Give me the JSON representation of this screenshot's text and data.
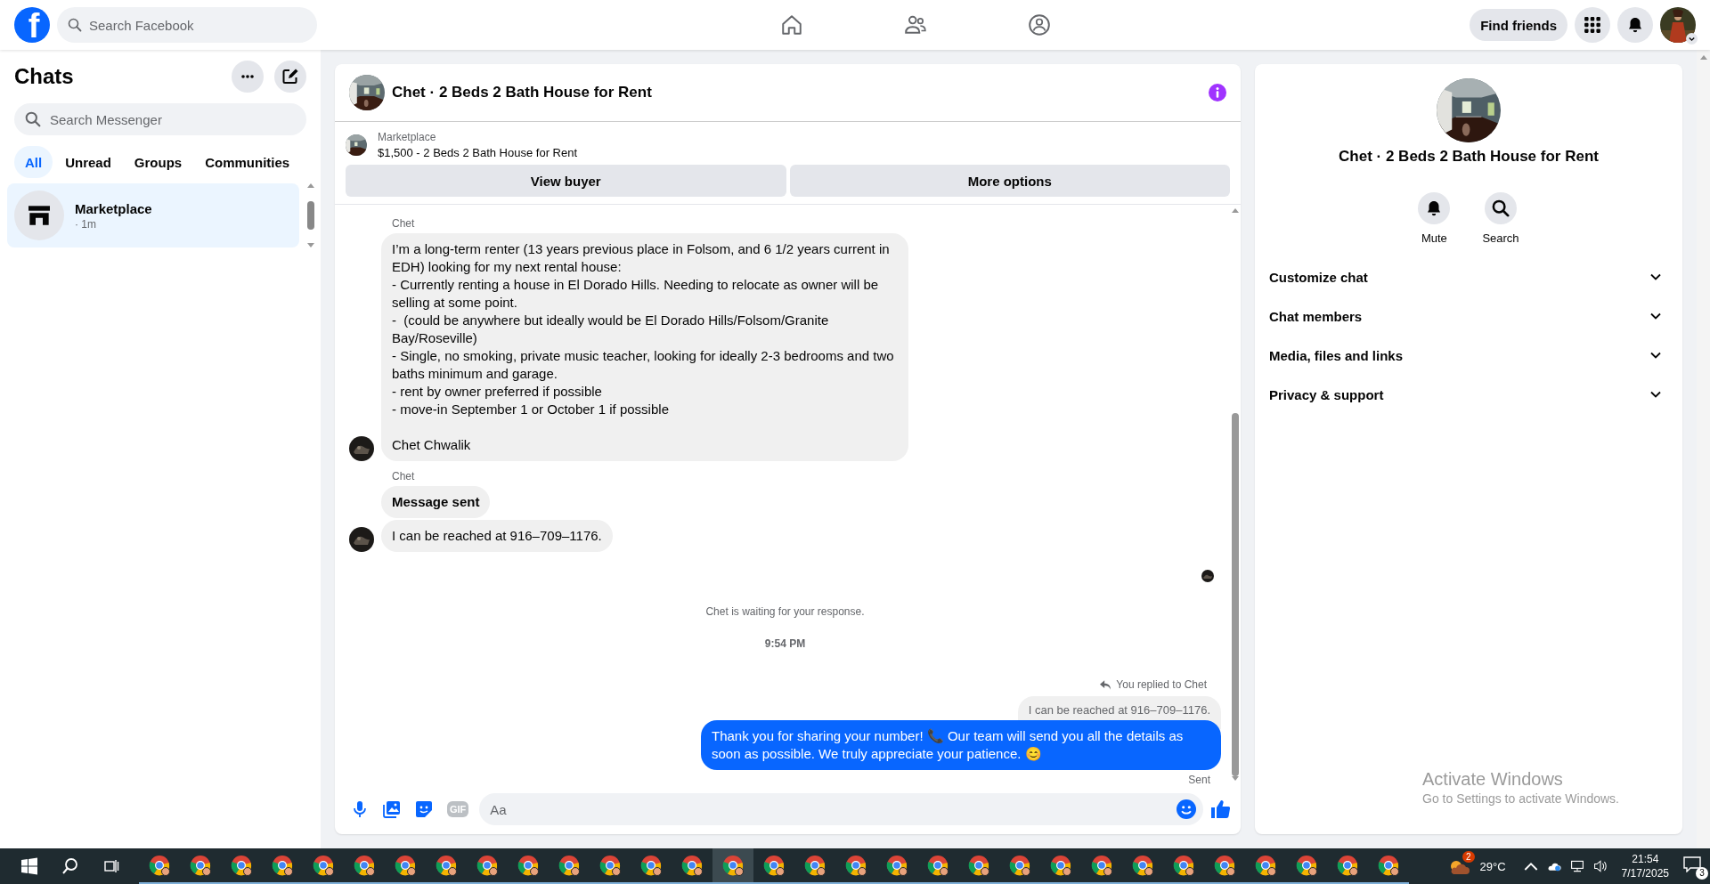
{
  "topbar": {
    "logo": "f",
    "search": {
      "placeholder": "Search Facebook"
    },
    "find_friends": "Find friends"
  },
  "sidebar": {
    "title": "Chats",
    "search": {
      "placeholder": "Search Messenger"
    },
    "filters": [
      {
        "label": "All",
        "selected": true
      },
      {
        "label": "Unread",
        "selected": false
      },
      {
        "label": "Groups",
        "selected": false
      },
      {
        "label": "Communities",
        "selected": false
      }
    ],
    "chats": [
      {
        "name": "Marketplace",
        "time": "· 1m",
        "selected": true
      }
    ]
  },
  "chat": {
    "title": "Chet · 2 Beds 2 Bath House for Rent",
    "listing": {
      "source": "Marketplace",
      "title": "$1,500 - 2 Beds 2 Bath House for Rent"
    },
    "buttons": [
      "View buyer",
      "More options"
    ],
    "messages": [
      {
        "kind": "name",
        "text": "Chet"
      },
      {
        "kind": "incoming",
        "avatar": true,
        "bold": false,
        "text": "I’m a long-term renter (13 years previous place in Folsom, and 6 1/2 years current in EDH) looking for my next rental house:\n- Currently renting a house in El Dorado Hills. Needing to relocate as owner will be selling at some point.\n-  (could be anywhere but ideally would be El Dorado Hills/Folsom/Granite Bay/Roseville)\n- Single, no smoking, private music teacher, looking for ideally 2-3 bedrooms and two baths minimum and garage.\n- rent by owner preferred if possible\n- move-in September 1 or October 1 if possible\n\nChet Chwalik"
      },
      {
        "kind": "name",
        "text": "Chet"
      },
      {
        "kind": "incoming",
        "avatar": false,
        "bold": true,
        "text": "Message sent"
      },
      {
        "kind": "incoming",
        "avatar": true,
        "bold": false,
        "text": "I can be reached at 916–709–1176."
      },
      {
        "kind": "seen"
      },
      {
        "kind": "notice",
        "text": "Chet is waiting for your response."
      },
      {
        "kind": "time",
        "text": "9:54 PM"
      },
      {
        "kind": "reply_header",
        "text": "You replied to Chet"
      },
      {
        "kind": "quoted",
        "text": "I can be reached at 916–709–1176."
      },
      {
        "kind": "outgoing",
        "text": "Thank you for sharing your number! 📞 Our team will send you all the details as soon as possible. We truly appreciate your patience. 😊"
      },
      {
        "kind": "status",
        "text": "Sent"
      }
    ],
    "composer": {
      "gif": "GIF",
      "placeholder": "Aa"
    }
  },
  "details": {
    "title": "Chet · 2 Beds 2 Bath House for Rent",
    "actions": [
      {
        "kind": "mute",
        "label": "Mute"
      },
      {
        "kind": "search",
        "label": "Search"
      }
    ],
    "sections": [
      {
        "label": "Customize chat",
        "expanded": false
      },
      {
        "label": "Chat members",
        "expanded": false
      },
      {
        "label": "Media, files and links",
        "expanded": false
      },
      {
        "label": "Privacy & support",
        "expanded": false
      }
    ]
  },
  "watermark": {
    "title": "Activate Windows",
    "subtitle": "Go to Settings to activate Windows."
  },
  "taskbar": {
    "apps": [
      {
        "selected": false
      },
      {
        "selected": false
      },
      {
        "selected": false
      },
      {
        "selected": false
      },
      {
        "selected": false
      },
      {
        "selected": false
      },
      {
        "selected": false
      },
      {
        "selected": false
      },
      {
        "selected": false
      },
      {
        "selected": false
      },
      {
        "selected": false
      },
      {
        "selected": false
      },
      {
        "selected": false
      },
      {
        "selected": false
      },
      {
        "selected": true
      },
      {
        "selected": false
      },
      {
        "selected": false
      },
      {
        "selected": false
      },
      {
        "selected": false
      },
      {
        "selected": false
      },
      {
        "selected": false
      },
      {
        "selected": false
      },
      {
        "selected": false
      },
      {
        "selected": false
      },
      {
        "selected": false
      },
      {
        "selected": false
      },
      {
        "selected": false
      },
      {
        "selected": false
      },
      {
        "selected": false
      },
      {
        "selected": false
      },
      {
        "selected": false
      }
    ],
    "weather_badge": "2",
    "temperature": "29°C",
    "time": "21:54",
    "date": "7/17/2025",
    "notifications": "3"
  }
}
